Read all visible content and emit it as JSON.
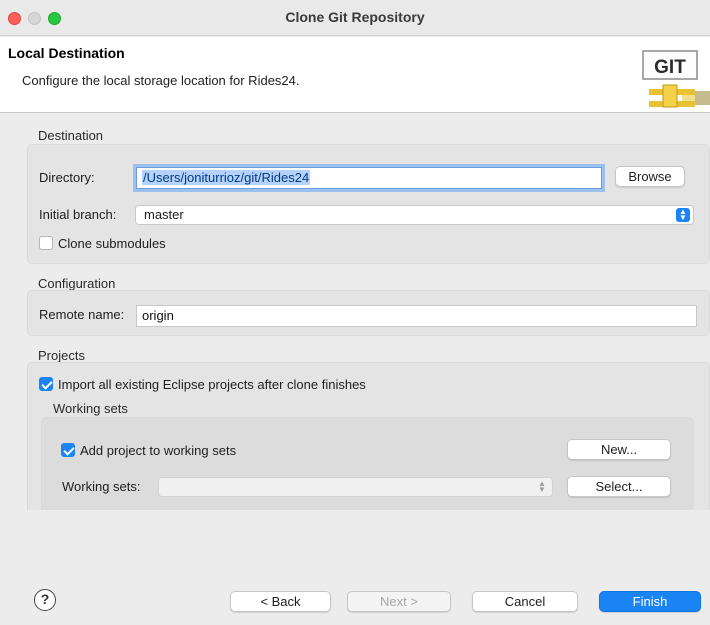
{
  "window": {
    "title": "Clone Git Repository"
  },
  "header": {
    "title": "Local Destination",
    "description": "Configure the local storage location for Rides24.",
    "logo_text": "GIT"
  },
  "destination": {
    "section_label": "Destination",
    "directory_label": "Directory:",
    "directory_value": "/Users/joniturrioz/git/Rides24",
    "browse_label": "Browse",
    "branch_label": "Initial branch:",
    "branch_value": "master",
    "clone_submodules_label": "Clone submodules",
    "clone_submodules_checked": false
  },
  "configuration": {
    "section_label": "Configuration",
    "remote_label": "Remote name:",
    "remote_value": "origin"
  },
  "projects": {
    "section_label": "Projects",
    "import_label": "Import all existing Eclipse projects after clone finishes",
    "import_checked": true,
    "working_sets_label": "Working sets",
    "add_to_ws_label": "Add project to working sets",
    "add_to_ws_checked": true,
    "new_label": "New...",
    "ws_field_label": "Working sets:",
    "ws_value": "",
    "select_label": "Select..."
  },
  "footer": {
    "help_glyph": "?",
    "back_label": "< Back",
    "next_label": "Next >",
    "cancel_label": "Cancel",
    "finish_label": "Finish"
  },
  "colors": {
    "accent": "#1b84f5",
    "close": "#fe5f57",
    "maximize": "#28c840"
  }
}
